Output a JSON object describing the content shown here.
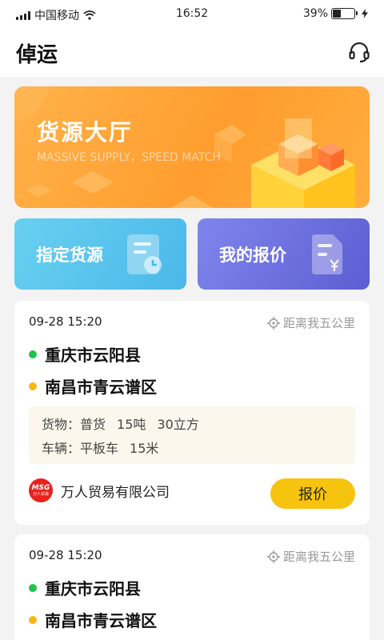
{
  "status_bar": {
    "carrier": "中国移动",
    "time": "16:52",
    "battery_text": "39%",
    "battery_level": 0.39
  },
  "header": {
    "title": "倬运",
    "icon": "headset-icon"
  },
  "banner": {
    "title": "货源大厅",
    "subtitle": "MASSIVE SUPPLY，SPEED MATCH",
    "color": "#ff9d2e"
  },
  "shortcuts": [
    {
      "label": "指定货源",
      "icon": "document-clock-icon",
      "color": "#4ab8ea"
    },
    {
      "label": "我的报价",
      "icon": "document-yen-icon",
      "color": "#5c5ed2"
    }
  ],
  "listings": [
    {
      "time": "09-28  15:20",
      "distance": "距离我五公里",
      "origin": "重庆市云阳县",
      "destination": "南昌市青云谱区",
      "cargo_label": "货物：",
      "cargo_type": "普货",
      "cargo_weight": "15吨",
      "cargo_volume": "30立方",
      "vehicle_label": "车辆：",
      "vehicle_type": "平板车",
      "vehicle_length": "15米",
      "company": "万人贸易有限公司",
      "logo_text": "MSG",
      "logo_subtext": "万人贸易",
      "button_label": "报价"
    },
    {
      "time": "09-28  15:20",
      "distance": "距离我五公里",
      "origin": "重庆市云阳县",
      "destination": "南昌市青云谱区"
    }
  ]
}
